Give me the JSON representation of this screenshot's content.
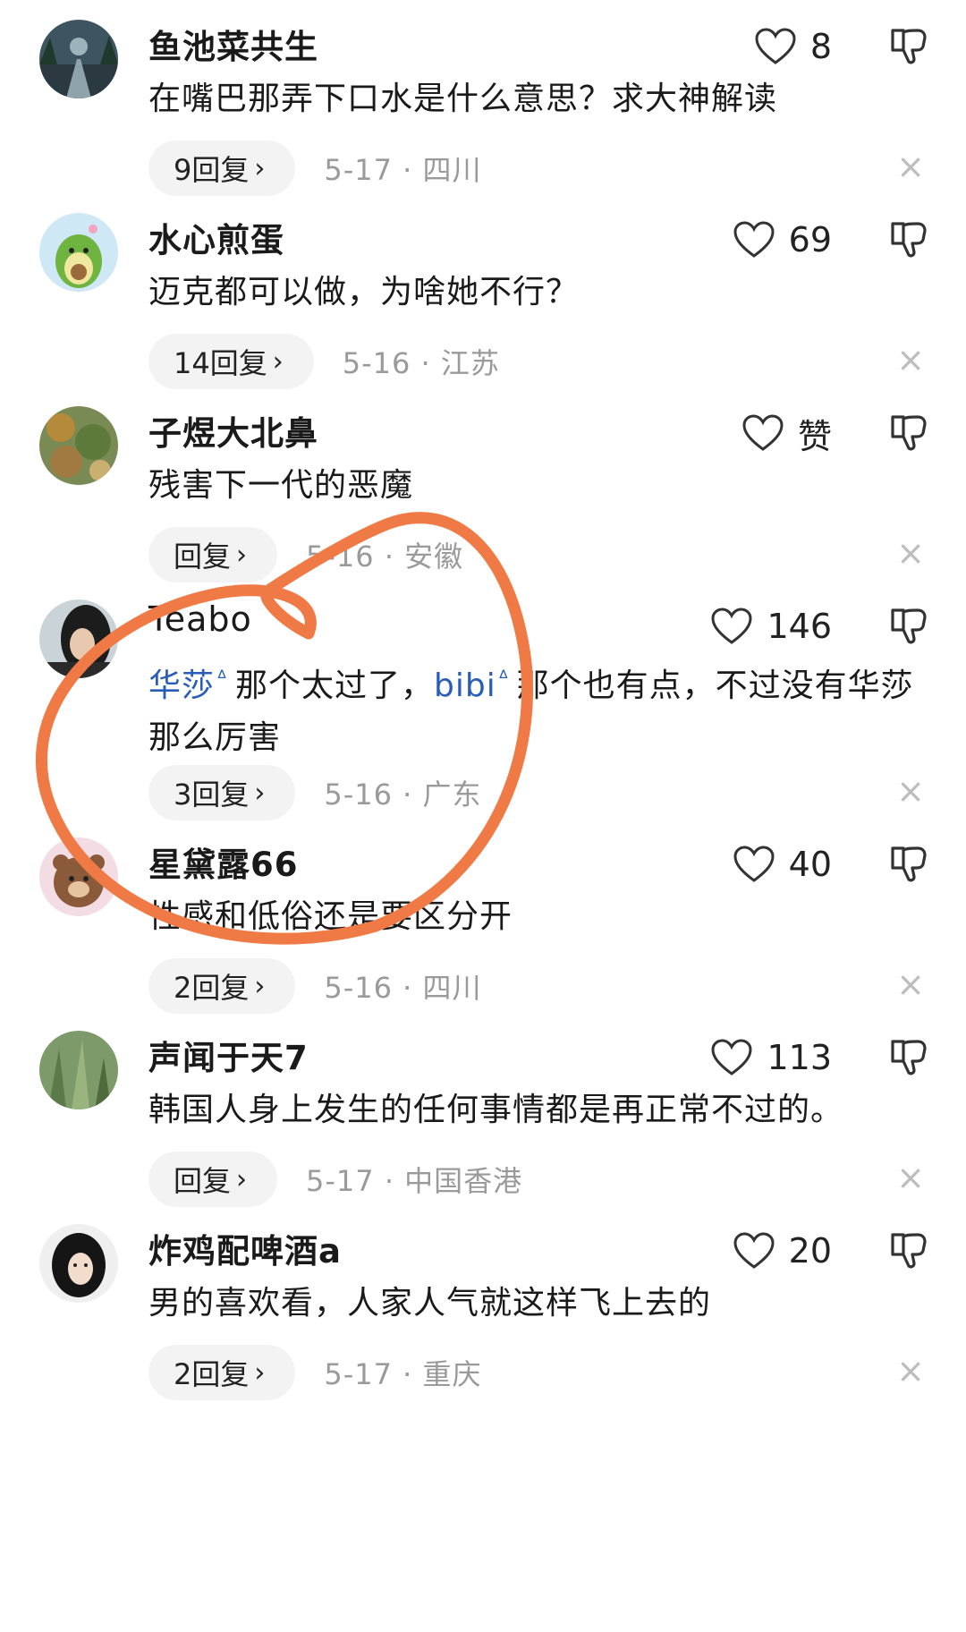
{
  "comments": [
    {
      "username": "鱼池菜共生",
      "text": "在嘴巴那弄下口水是什么意思？求大神解读",
      "likes": "8",
      "replies": "9回复",
      "date": "5-17",
      "location": "四川"
    },
    {
      "username": "水心煎蛋",
      "text": "迈克都可以做，为啥她不行？",
      "likes": "69",
      "replies": "14回复",
      "date": "5-16",
      "location": "江苏"
    },
    {
      "username": "子煜大北鼻",
      "text": "残害下一代的恶魔",
      "likes": "赞",
      "replies": "回复",
      "date": "5-16",
      "location": "安徽"
    },
    {
      "username": "Teabo",
      "mention1": "华莎",
      "text_a": "那个太过了，",
      "mention2": "bibi",
      "text_b": "那个也有点，不过没有华莎那么厉害",
      "likes": "146",
      "replies": "3回复",
      "date": "5-16",
      "location": "广东"
    },
    {
      "username": "星黛露66",
      "text": "性感和低俗还是要区分开",
      "likes": "40",
      "replies": "2回复",
      "date": "5-16",
      "location": "四川"
    },
    {
      "username": "声闻于天7",
      "text": "韩国人身上发生的任何事情都是再正常不过的。",
      "likes": "113",
      "replies": "回复",
      "date": "5-17",
      "location": "中国香港"
    },
    {
      "username": "炸鸡配啤酒a",
      "text": "男的喜欢看，人家人气就这样飞上去的",
      "likes": "20",
      "replies": "2回复",
      "date": "5-17",
      "location": "重庆"
    }
  ],
  "separator": " · ",
  "reply_chevron": "›",
  "close_glyph": "×",
  "mention_glyph": "ᐞ",
  "colors": {
    "mention": "#2a5db8",
    "annotation": "#f07a45",
    "meta": "#9a9a9a"
  },
  "icons": {
    "like": "heart-outline-icon",
    "dislike": "thumbs-down-icon",
    "close": "close-icon",
    "search": "search-icon"
  }
}
